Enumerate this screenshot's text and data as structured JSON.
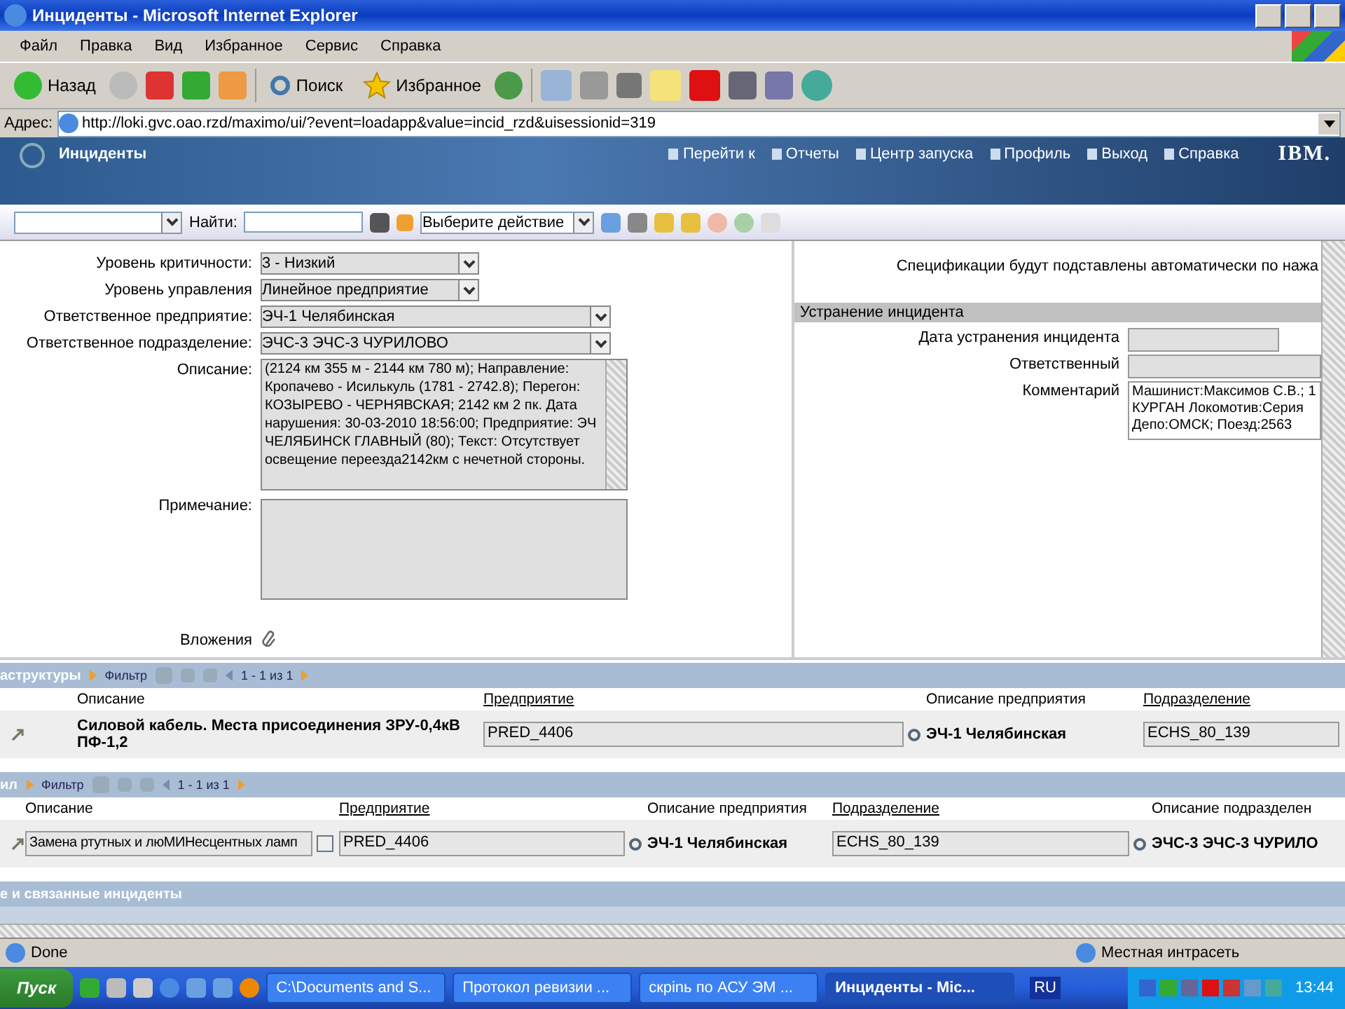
{
  "window": {
    "title": "Инциденты - Microsoft Internet Explorer"
  },
  "menu": [
    "Файл",
    "Правка",
    "Вид",
    "Избранное",
    "Сервис",
    "Справка"
  ],
  "toolbar": {
    "back": "Назад",
    "search": "Поиск",
    "favorites": "Избранное"
  },
  "address": {
    "label": "Адрес:",
    "url": "http://loki.gvc.oao.rzd/maximo/ui/?event=loadapp&value=incid_rzd&uisessionid=319"
  },
  "app_header": {
    "title": "Инциденты",
    "links": [
      "Перейти к",
      "Отчеты",
      "Центр запуска",
      "Профиль",
      "Выход",
      "Справка"
    ],
    "logo": "IBM."
  },
  "app_toolbar": {
    "find_label": "Найти:",
    "action": "Выберите действие"
  },
  "form_left": [
    {
      "kind": "select",
      "label": "Уровень критичности:",
      "value": "3 - Низкий",
      "wide": false
    },
    {
      "kind": "select",
      "label": "Уровень управления",
      "value": "Линейное предприятие",
      "wide": false
    },
    {
      "kind": "select",
      "label": "Ответственное предприятие:",
      "value": "ЭЧ-1 Челябинская",
      "wide": true
    },
    {
      "kind": "select",
      "label": "Ответственное подразделение:",
      "value": "ЭЧС-3 ЭЧС-3 ЧУРИЛОВО",
      "wide": true
    },
    {
      "kind": "textarea",
      "label": "Описание:",
      "value": "(2124 км 355 м - 2144 км 780 м); Направление: Кропачево - Исилькуль (1781 - 2742.8); Перегон: КОЗЫРЕВО - ЧЕРНЯВСКАЯ; 2142 км 2 пк. Дата нарушения: 30-03-2010 18:56:00; Предприятие: ЭЧ ЧЕЛЯБИНСК ГЛАВНЫЙ (80); Текст: Отсутствует освещение переезда2142км с нечетной стороны."
    },
    {
      "kind": "textarea",
      "label": "Примечание:"
    },
    {
      "kind": "attachments",
      "label": "Вложения"
    }
  ],
  "form_right": {
    "note": "Спецификации будут подставлены автоматически по нажа",
    "section_title": "Устранение инцидента",
    "fields": [
      {
        "kind": "input",
        "label": "Дата устранения инцидента",
        "wide": false
      },
      {
        "kind": "input",
        "label": "Ответственный",
        "wide": true
      },
      {
        "kind": "textarea",
        "label": "Комментарий",
        "value": "Машинист:Максимов С.В.; 1 КУРГАН Локомотив:Серия Депо:ОМСК; Поезд:2563"
      }
    ]
  },
  "sections": [
    {
      "title": "аструктуры",
      "filter": "Фильтр",
      "pager": "1 - 1 из 1",
      "columns": [
        {
          "label": "Описание",
          "link": false
        },
        {
          "label": "Предприятие",
          "link": true
        },
        {
          "label": "Описание предприятия",
          "link": false
        },
        {
          "label": "Подразделение",
          "link": true
        }
      ],
      "row": [
        {
          "kind": "bold",
          "value": "Силовой кабель. Места присоединения ЗРУ-0,4кВ ПФ-1,2"
        },
        {
          "kind": "lookup",
          "value": "PRED_4406"
        },
        {
          "kind": "bold",
          "value": "ЭЧ-1 Челябинская"
        },
        {
          "kind": "field",
          "value": "ECHS_80_139"
        }
      ]
    },
    {
      "title": "ил",
      "filter": "Фильтр",
      "pager": "1 - 1 из 1",
      "columns": [
        {
          "label": "Описание",
          "link": false
        },
        {
          "label": "Предприятие",
          "link": true
        },
        {
          "label": "Описание предприятия",
          "link": false
        },
        {
          "label": "Подразделение",
          "link": true
        },
        {
          "label": "Описание подразделен",
          "link": false
        }
      ],
      "row": [
        {
          "kind": "detail",
          "value": "Замена ртутных и люМИНесцентных ламп"
        },
        {
          "kind": "lookup",
          "value": "PRED_4406"
        },
        {
          "kind": "bold",
          "value": "ЭЧ-1 Челябинская"
        },
        {
          "kind": "lookup",
          "value": "ECHS_80_139"
        },
        {
          "kind": "bold",
          "value": "ЭЧС-3 ЭЧС-3 ЧУРИЛО"
        }
      ]
    },
    {
      "title": "е и связанные инциденты"
    }
  ],
  "status_bar": {
    "text": "Done",
    "zone": "Местная интрасеть"
  },
  "taskbar": {
    "start": "Пуск",
    "tasks": [
      {
        "label": "C:\\Documents and S...",
        "selected": false
      },
      {
        "label": "Протокол ревизии ...",
        "selected": false
      },
      {
        "label": "скрinь по АСУ ЭМ ...",
        "selected": false
      },
      {
        "label": "Инциденты - Mic...",
        "selected": true
      }
    ],
    "lang": "RU",
    "clock": "13:44"
  }
}
